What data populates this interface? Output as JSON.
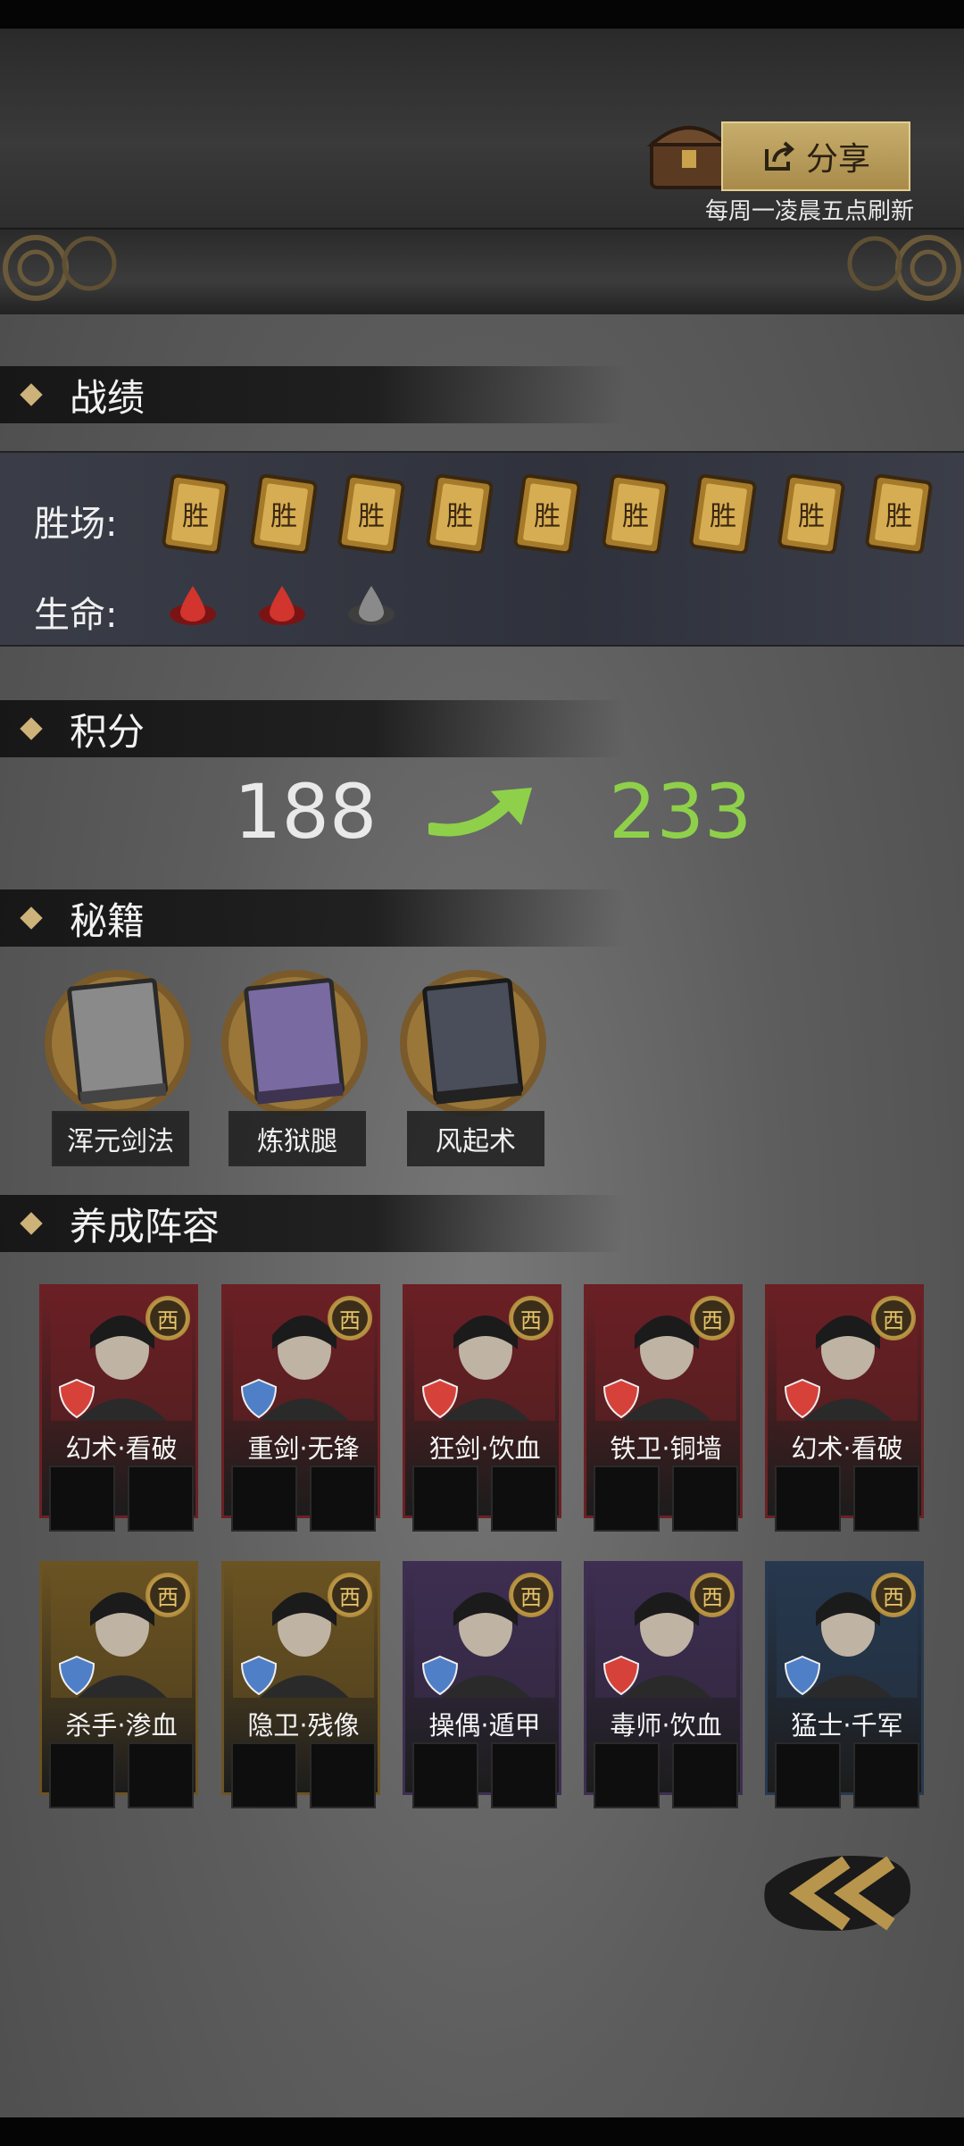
{
  "header": {
    "share_label": "分享",
    "refresh_note": "每周一凌晨五点刷新"
  },
  "sections": {
    "record": "战绩",
    "score": "积分",
    "secrets": "秘籍",
    "lineup": "养成阵容"
  },
  "record": {
    "wins_label": "胜场:",
    "life_label": "生命:",
    "win_card_text": "胜",
    "wins": 9,
    "lives_total": 3,
    "lives_remaining": 2
  },
  "score": {
    "old": "188",
    "new": "233",
    "new_color": "#8fd04a"
  },
  "books": [
    {
      "name": "浑元剑法",
      "icon": "grey-book-icon"
    },
    {
      "name": "炼狱腿",
      "icon": "purple-book-icon"
    },
    {
      "name": "风起术",
      "icon": "dark-book-icon"
    }
  ],
  "heroes": [
    {
      "name": "幻术·看破",
      "badge": "西",
      "frame": "red",
      "class_icon": "swirl-icon"
    },
    {
      "name": "重剑·无锋",
      "badge": "西",
      "frame": "red",
      "class_icon": "blue-swirl-icon"
    },
    {
      "name": "狂剑·饮血",
      "badge": "西",
      "frame": "red",
      "class_icon": "red-plus-shield-icon"
    },
    {
      "name": "铁卫·铜墙",
      "badge": "西",
      "frame": "red",
      "class_icon": "red-shield-icon"
    },
    {
      "name": "幻术·看破",
      "badge": "西",
      "frame": "red",
      "class_icon": "swirl-icon"
    },
    {
      "name": "杀手·渗血",
      "badge": "西",
      "frame": "gold",
      "class_icon": "blue-plus-shield-icon"
    },
    {
      "name": "隐卫·残像",
      "badge": "西",
      "frame": "gold",
      "class_icon": "blue-swirl-icon"
    },
    {
      "name": "操偶·遁甲",
      "badge": "西",
      "frame": "purple",
      "class_icon": "blue-shield-icon"
    },
    {
      "name": "毒师·饮血",
      "badge": "西",
      "frame": "purple",
      "class_icon": "red-plus-shield-icon"
    },
    {
      "name": "猛士·千军",
      "badge": "西",
      "frame": "blue",
      "class_icon": "blue-minus-shield-icon"
    }
  ],
  "colors": {
    "accent_gold": "#cdb27a",
    "frame_red": "#6b2024",
    "frame_gold": "#6b5322",
    "frame_purple": "#3e2e52",
    "frame_blue": "#27384f"
  }
}
